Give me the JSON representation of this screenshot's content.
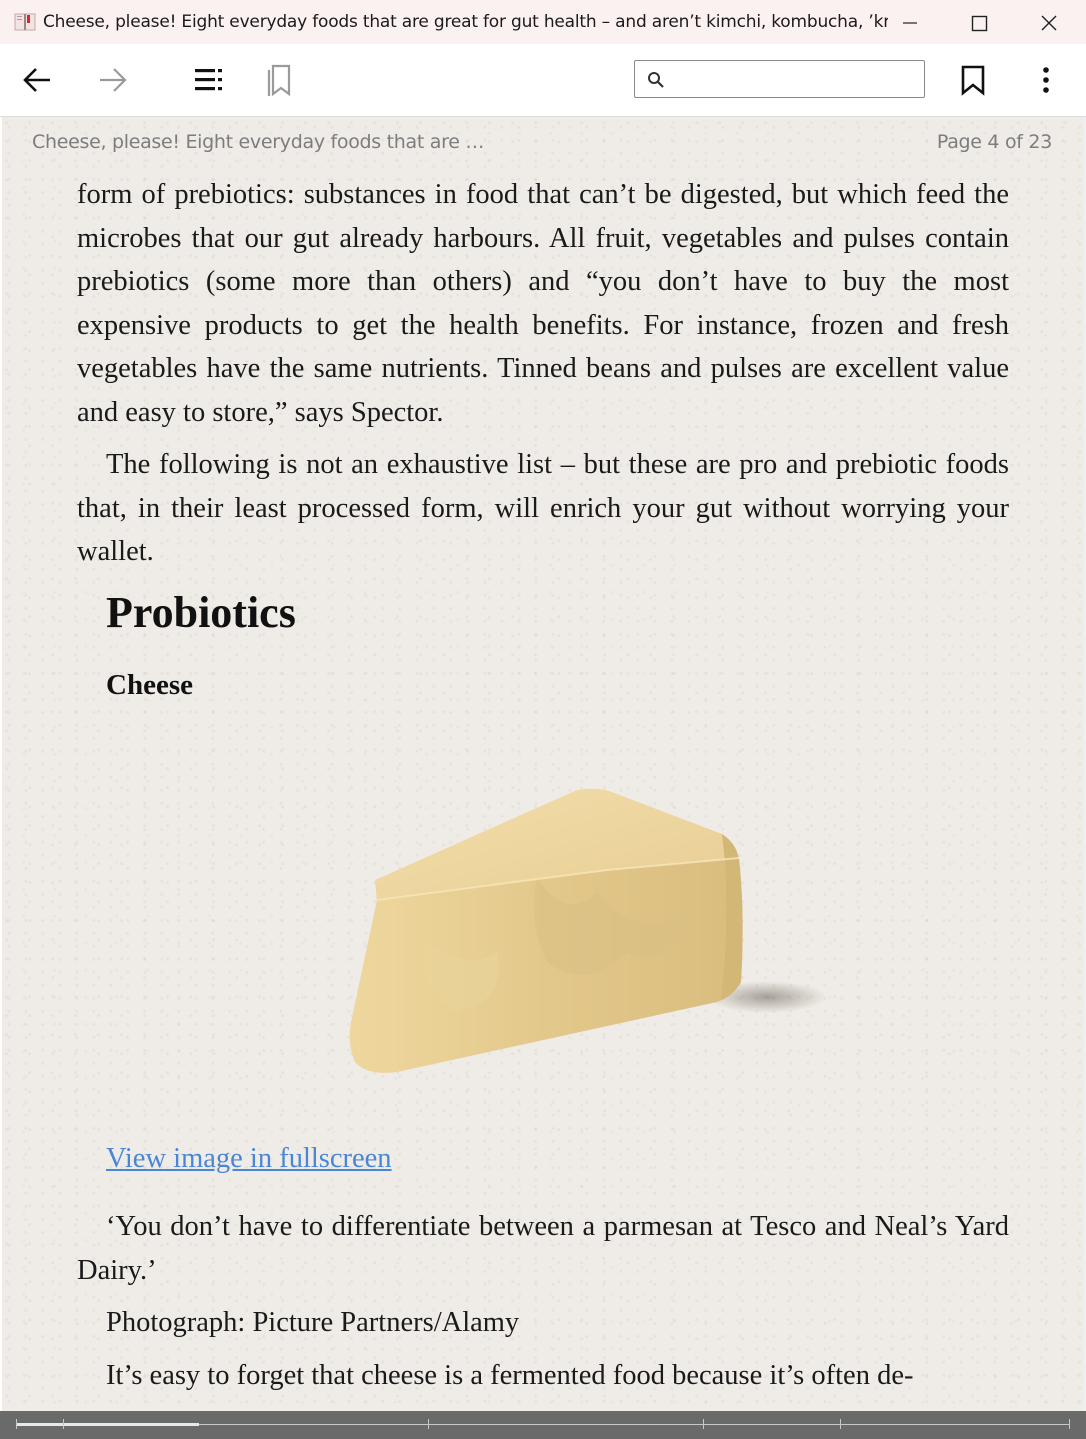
{
  "window": {
    "title": "Cheese, please! Eight everyday foods that are great for gut health – and aren’t kimchi, kombucha, ’krau…",
    "minimize_label": "minimize",
    "maximize_label": "maximize",
    "close_label": "close"
  },
  "toolbar": {
    "back_icon": "arrow-left-icon",
    "forward_icon": "arrow-right-icon",
    "contents_icon": "table-of-contents-icon",
    "bookmarks_list_icon": "bookmarks-icon",
    "search": {
      "value": "",
      "placeholder": ""
    },
    "bookmark_icon": "bookmark-icon",
    "more_icon": "more-vertical-icon"
  },
  "reader": {
    "running_head": "Cheese, please! Eight everyday foods that are …",
    "page_label": "Page 4 of 23",
    "paragraph_1": "form of prebiotics: substances in food that can’t be digested, but which feed the microbes that our gut already harbours. All fruit, vegetables and pulses contain prebiotics (some more than others) and “you don’t have to buy the most expensive products to get the health benefits. For instance, frozen and fresh vegetables have the same nutrients. Tinned beans and pulses are excellent value and easy to store,” says Spector.",
    "paragraph_2": "The following is not an exhaustive list – but these are pro and prebiotic foods that, in their least processed form, will enrich your gut without worrying your wallet.",
    "heading_probiotics": "Probiotics",
    "heading_cheese": "Cheese",
    "image_alt": "wedge of parmesan cheese",
    "fullscreen_link": "View image in fullscreen",
    "caption": "‘You don’t have to differentiate between a parmesan at Tesco and Neal’s Yard Dairy.’",
    "credit": "Photograph: Picture Partners/Alamy",
    "paragraph_3": "It’s easy to forget that cheese is a fermented food because it’s often de-"
  },
  "progress": {
    "current_page": 4,
    "total_pages": 23,
    "fraction": 0.174
  },
  "colors": {
    "page_background": "#efece7",
    "link": "#4a86d6",
    "progress_bar": "#6a6a6a",
    "titlebar": "#fbf1f1"
  }
}
